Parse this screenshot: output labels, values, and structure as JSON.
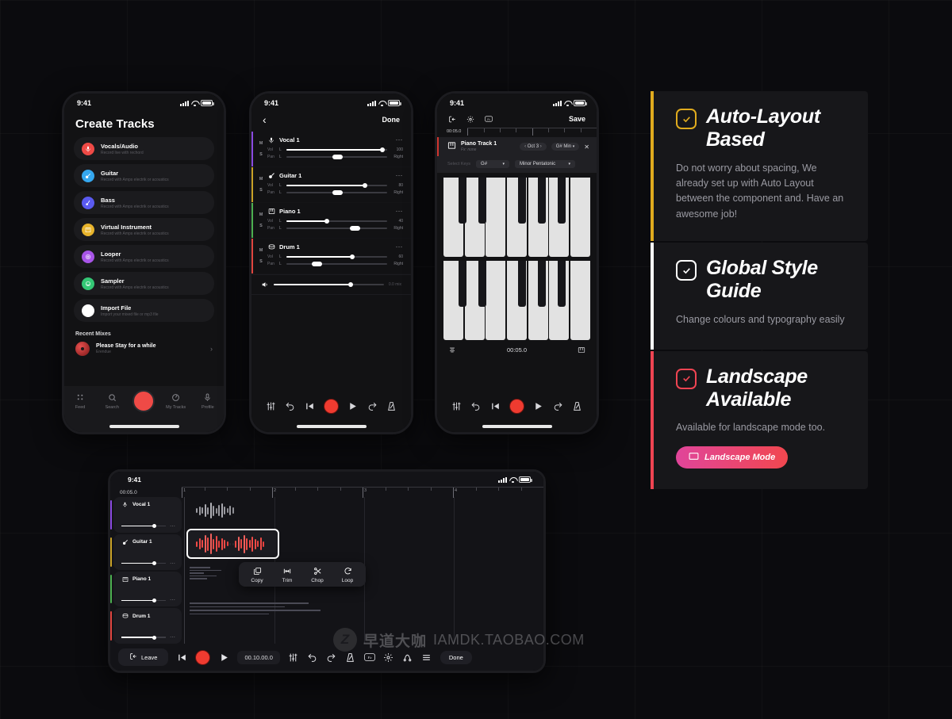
{
  "status_bar": {
    "time": "9:41",
    "signal_icon": "signal-bars-icon",
    "wifi_icon": "wifi-icon",
    "battery_icon": "battery-icon"
  },
  "phone_create_tracks": {
    "title": "Create Tracks",
    "options": [
      {
        "name": "Vocals/Audio",
        "subtitle": "Record live with rechord",
        "color": "#ef4a46",
        "icon": "microphone-icon"
      },
      {
        "name": "Guitar",
        "subtitle": "Record with Amps electrik or acoustics",
        "color": "#35a8f0",
        "icon": "guitar-icon"
      },
      {
        "name": "Bass",
        "subtitle": "Record with Amps electrik or acoustics",
        "color": "#5a5af0",
        "icon": "bass-icon"
      },
      {
        "name": "Virtual Instrument",
        "subtitle": "Record with Amps electrik or acoustics",
        "color": "#e8b42c",
        "icon": "piano-icon"
      },
      {
        "name": "Looper",
        "subtitle": "Record with Amps electrik or acoustics",
        "color": "#a855e8",
        "icon": "loop-icon"
      },
      {
        "name": "Sampler",
        "subtitle": "Record with Amps electrik or acoustics",
        "color": "#34c775",
        "icon": "sampler-icon"
      },
      {
        "name": "Import File",
        "subtitle": "Import your mixed file or mp3 file",
        "color": "#ffffff",
        "icon": "import-icon"
      }
    ],
    "recent_section": "Recent Mixes",
    "recent": {
      "title": "Please Stay for a while",
      "artist": "Erendue",
      "chevron": "chevron-right-icon"
    },
    "tabs": [
      {
        "label": "Feed",
        "icon": "grid-icon"
      },
      {
        "label": "Search",
        "icon": "search-icon"
      },
      {
        "label": "",
        "icon": "record-icon"
      },
      {
        "label": "My Tracks",
        "icon": "disc-icon"
      },
      {
        "label": "Profile",
        "icon": "person-icon"
      }
    ]
  },
  "phone_mixer": {
    "back_icon": "chevron-left-icon",
    "done_label": "Done",
    "mute_label": "M",
    "solo_label": "S",
    "vol_label": "Vol",
    "pan_label": "Pan",
    "pan_left": "L",
    "pan_right": "Right",
    "more_icon": "more-horizontal-icon",
    "tracks": [
      {
        "name": "Vocal 1",
        "icon": "microphone-icon",
        "color": "#8a4ae0",
        "volume": 100,
        "vol_pct": 95,
        "pan_pct": 50
      },
      {
        "name": "Guitar 1",
        "icon": "guitar-icon",
        "color": "#c9a227",
        "volume": 80,
        "vol_pct": 78,
        "pan_pct": 50
      },
      {
        "name": "Piano 1",
        "icon": "piano-icon",
        "color": "#4caf50",
        "volume": 40,
        "vol_pct": 40,
        "pan_pct": 68
      },
      {
        "name": "Drum 1",
        "icon": "drum-icon",
        "color": "#e0453f",
        "volume": 60,
        "vol_pct": 65,
        "pan_pct": 30
      }
    ],
    "master": {
      "icon": "speaker-icon",
      "value": "0.0 mix",
      "pct": 70
    },
    "transport": [
      {
        "icon": "mixer-icon"
      },
      {
        "icon": "undo-icon"
      },
      {
        "icon": "skip-back-icon"
      },
      {
        "icon": "record-icon"
      },
      {
        "icon": "play-icon"
      },
      {
        "icon": "redo-icon"
      },
      {
        "icon": "metronome-icon"
      }
    ]
  },
  "phone_piano": {
    "nav_icons": [
      "exit-icon",
      "gear-icon",
      "fx-icon"
    ],
    "save_label": "Save",
    "timecode": "00:05.0",
    "track": {
      "name": "Piano Track 1",
      "fx": "Fx: none",
      "icon": "piano-icon",
      "octave": "Oct 3",
      "key": "G# Min",
      "close_icon": "close-icon",
      "prev_icon": "chevron-left-icon",
      "next_icon": "chevron-right-icon",
      "dropdown_icon": "chevron-down-icon"
    },
    "keys_label": "Select Keys",
    "key_value": "G#",
    "scale_value": "Minor Pentatonic",
    "footer_time": "00:05.0",
    "footer_left_icon": "tuner-icon",
    "footer_right_icon": "keyboard-icon",
    "transport": [
      {
        "icon": "mixer-icon"
      },
      {
        "icon": "undo-icon"
      },
      {
        "icon": "skip-back-icon"
      },
      {
        "icon": "record-icon"
      },
      {
        "icon": "play-icon"
      },
      {
        "icon": "redo-icon"
      },
      {
        "icon": "metronome-icon"
      }
    ]
  },
  "tablet": {
    "time": "9:41",
    "timecode": "00:05.0",
    "ruler_labels": [
      "1",
      "2",
      "3",
      "4"
    ],
    "tracks": [
      {
        "name": "Vocal 1",
        "icon": "microphone-icon",
        "color": "#8a4ae0",
        "vol_pct": 74
      },
      {
        "name": "Guitar 1",
        "icon": "guitar-icon",
        "color": "#c9a227",
        "vol_pct": 74
      },
      {
        "name": "Piano 1",
        "icon": "piano-icon",
        "color": "#4caf50",
        "vol_pct": 74
      },
      {
        "name": "Drum 1",
        "icon": "drum-icon",
        "color": "#e0453f",
        "vol_pct": 74
      }
    ],
    "context_menu": [
      {
        "label": "Copy",
        "icon": "copy-icon"
      },
      {
        "label": "Trim",
        "icon": "trim-icon"
      },
      {
        "label": "Chop",
        "icon": "scissors-icon"
      },
      {
        "label": "Loop",
        "icon": "loop-icon"
      }
    ],
    "leave_label": "Leave",
    "leave_icon": "exit-icon",
    "transport_timecode": "00.10.00.0",
    "done_label": "Done",
    "toolbar_icons": [
      "mixer-icon",
      "undo-icon",
      "redo-icon",
      "metronome-icon",
      "fx-icon",
      "gear-icon",
      "automation-icon",
      "menu-icon"
    ]
  },
  "feature_cards": [
    {
      "title": "Auto-Layout Based",
      "body": "Do not worry about spacing, We already set up with Auto Layout between the component and. Have an awesome job!",
      "accent": "#e0ab1e",
      "check_icon": "check-box-icon"
    },
    {
      "title": "Global Style Guide",
      "body": "Change colours and typography easily",
      "accent": "#ffffff",
      "check_icon": "check-box-icon"
    },
    {
      "title": "Landscape Available",
      "body": "Available for landscape mode too.",
      "accent": "#ef4452",
      "check_icon": "check-box-icon",
      "button": {
        "label": "Landscape Mode",
        "icon": "landscape-icon"
      }
    }
  ],
  "watermark": {
    "logo": "Z",
    "text_cn": "早道大咖",
    "text_en": "IAMDK.TAOBAO.COM"
  }
}
